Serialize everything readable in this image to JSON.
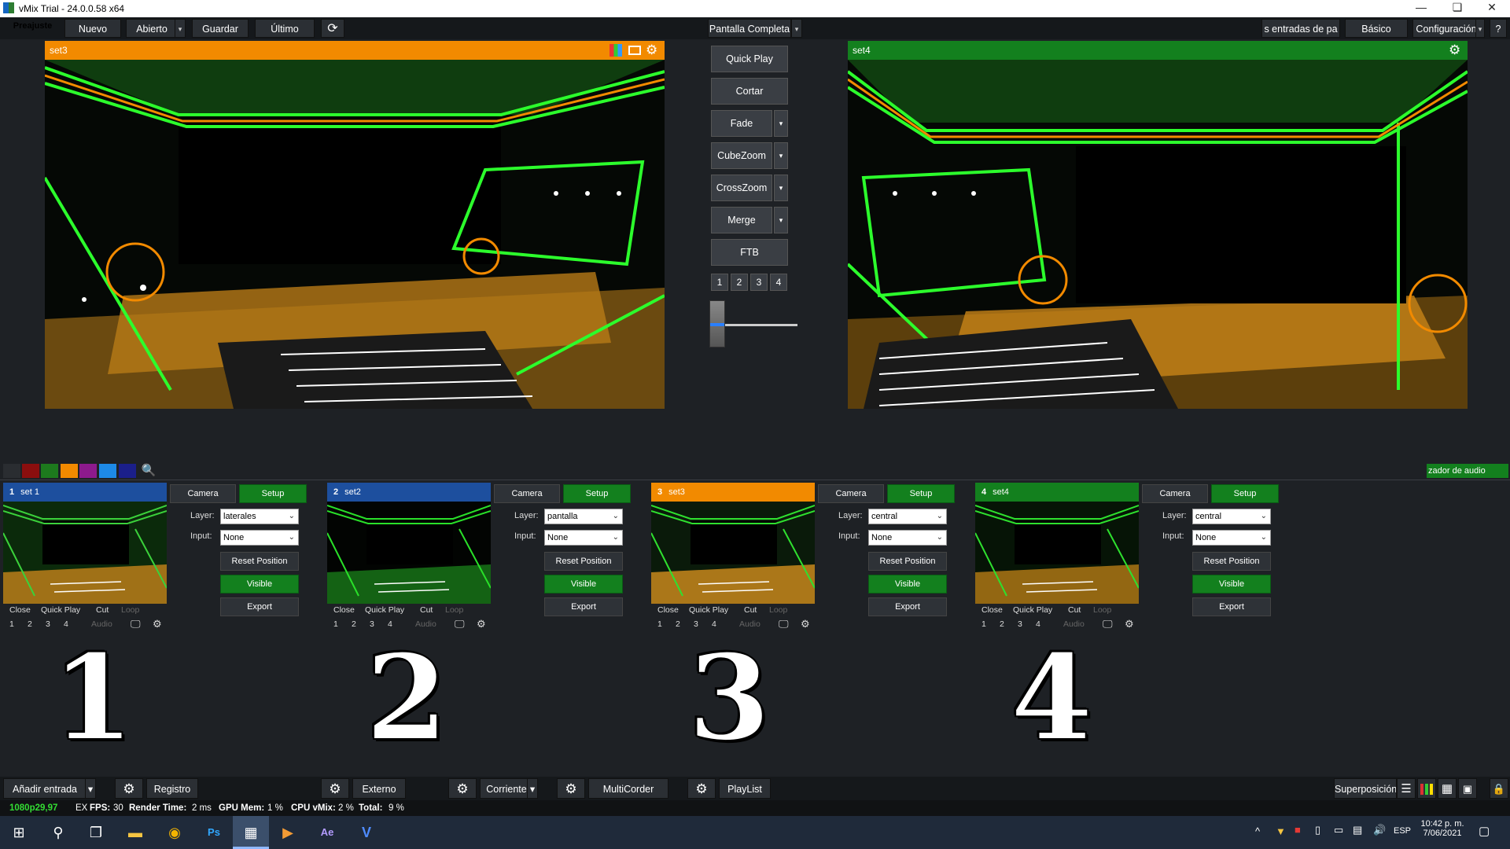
{
  "window": {
    "title": "vMix Trial - 24.0.0.58 x64"
  },
  "toolbar": {
    "preset": "Preajuste",
    "new": "Nuevo",
    "open": "Abierto",
    "save": "Guardar",
    "last": "Último",
    "fullscreen": "Pantalla Completa",
    "inputs_label": "s entradas de pa",
    "basic": "Básico",
    "settings": "Configuración",
    "help": "?"
  },
  "preview": {
    "label": "set3"
  },
  "output": {
    "label": "set4"
  },
  "transitions": {
    "quickplay": "Quick Play",
    "cut": "Cortar",
    "fade": "Fade",
    "cubezoom": "CubeZoom",
    "crosszoom": "CrossZoom",
    "merge": "Merge",
    "ftb": "FTB",
    "numbers": [
      "1",
      "2",
      "3",
      "4"
    ],
    "tbar_position": 0
  },
  "filters": {
    "colors": [
      "#2a2d31",
      "#8b0e0e",
      "#1d7a1d",
      "#f28a00",
      "#8d1a8d",
      "#1d8ae8",
      "#1b1f8a"
    ],
    "audio_mixer": "zador de audio"
  },
  "inputs": [
    {
      "num": "1",
      "name": "set 1",
      "color": "#1d4f9e",
      "layer": "laterales",
      "input": "None"
    },
    {
      "num": "2",
      "name": "set2",
      "color": "#1d4f9e",
      "layer": "pantalla",
      "input": "None"
    },
    {
      "num": "3",
      "name": "set3",
      "color": "#f28a00",
      "layer": "central",
      "input": "None"
    },
    {
      "num": "4",
      "name": "set4",
      "color": "#13801e",
      "layer": "central",
      "input": "None"
    }
  ],
  "input_labels": {
    "camera": "Camera",
    "setup": "Setup",
    "layer": "Layer:",
    "input": "Input:",
    "reset": "Reset Position",
    "visible": "Visible",
    "export": "Export",
    "close": "Close",
    "quickplay": "Quick Play",
    "cut": "Cut",
    "loop": "Loop",
    "audio": "Audio",
    "n1": "1",
    "n2": "2",
    "n3": "3",
    "n4": "4"
  },
  "big_numbers": [
    "1",
    "2",
    "3",
    "4"
  ],
  "bottom": {
    "add_input": "Añadir entrada",
    "log": "Registro",
    "external": "Externo",
    "stream": "Corriente",
    "multicorder": "MultiCorder",
    "playlist": "PlayList",
    "overlay": "Superposición"
  },
  "status": {
    "format": "1080p29,97",
    "ex": "EX",
    "fps_label": "FPS:",
    "fps": "30",
    "render_label": "Render Time:",
    "render": "2 ms",
    "gpu_label": "GPU Mem:",
    "gpu": "1 %",
    "cpu_label": "CPU vMix:",
    "cpu": "2 %",
    "total_label": "Total:",
    "total": "9 %"
  },
  "taskbar": {
    "time": "10:42 p. m.",
    "date": "7/06/2021",
    "lang": "ESP"
  }
}
